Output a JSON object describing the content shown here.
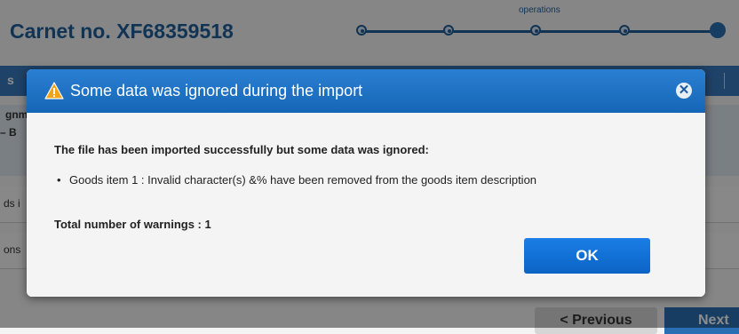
{
  "page": {
    "carnet_title": "Carnet no. XF68359518",
    "progress_label": "operations",
    "nav_left": "s",
    "section_text1": "gnm",
    "section_text2": "– B",
    "row1_text": "ds i",
    "row2_text": "ons",
    "prev_label": "< Previous",
    "next_label": "Next"
  },
  "dialog": {
    "title": "Some data was ignored during the import",
    "icon": "warning-icon",
    "close_icon": "close-icon",
    "message_heading": "The file has been imported successfully but some data was ignored:",
    "items": [
      "Goods item 1 : Invalid character(s) &% have been removed from the goods item description"
    ],
    "total_warnings": "Total number of warnings : 1",
    "ok_label": "OK"
  },
  "colors": {
    "header_blue": "#1566b5",
    "accent_blue": "#1f5f9c",
    "warning_orange": "#f0a31b"
  }
}
